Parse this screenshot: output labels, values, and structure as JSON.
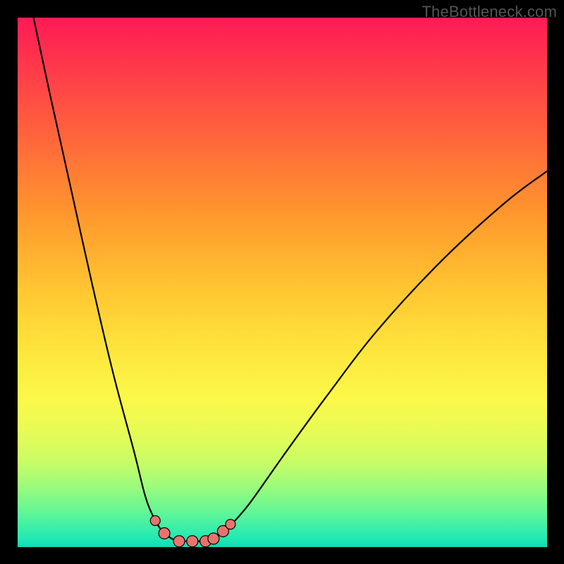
{
  "watermark": "TheBottleneck.com",
  "chart_data": {
    "type": "line",
    "title": "",
    "xlabel": "",
    "ylabel": "",
    "xlim": [
      0,
      100
    ],
    "ylim": [
      0,
      100
    ],
    "grid": false,
    "legend": false,
    "series": [
      {
        "name": "left-curve",
        "x": [
          3,
          6,
          10,
          14,
          18,
          22,
          24,
          25.5,
          27,
          28.5,
          29.5,
          30.5
        ],
        "y": [
          100,
          86,
          68,
          50,
          33,
          18,
          10,
          6,
          3.4,
          2,
          1.4,
          1.1
        ]
      },
      {
        "name": "right-curve",
        "x": [
          36,
          37,
          38.5,
          40.5,
          44,
          50,
          58,
          68,
          80,
          92,
          100
        ],
        "y": [
          1.1,
          1.5,
          2.6,
          4.4,
          8.5,
          17,
          28,
          41,
          54,
          65,
          71
        ]
      },
      {
        "name": "floor-segment",
        "x": [
          30.5,
          36
        ],
        "y": [
          1.1,
          1.1
        ]
      }
    ],
    "markers": [
      {
        "name": "left-top-dot",
        "x": 26.0,
        "y": 5.0,
        "r": 7
      },
      {
        "name": "left-bottom-dot",
        "x": 27.7,
        "y": 2.6,
        "r": 8
      },
      {
        "name": "floor-left-dot",
        "x": 30.5,
        "y": 1.1,
        "r": 8
      },
      {
        "name": "floor-mid-dot",
        "x": 33.0,
        "y": 1.1,
        "r": 8
      },
      {
        "name": "floor-right-dot",
        "x": 35.5,
        "y": 1.1,
        "r": 8
      },
      {
        "name": "right-low-dot",
        "x": 37.0,
        "y": 1.6,
        "r": 8
      },
      {
        "name": "right-mid-dot",
        "x": 38.8,
        "y": 3.0,
        "r": 8
      },
      {
        "name": "right-top-dot",
        "x": 40.2,
        "y": 4.3,
        "r": 7
      }
    ],
    "marker_style": {
      "fill": "#e8736e",
      "stroke": "#000000",
      "stroke_width": 1.2
    },
    "line_style": {
      "stroke": "#000000",
      "stroke_width": 2.2
    }
  }
}
